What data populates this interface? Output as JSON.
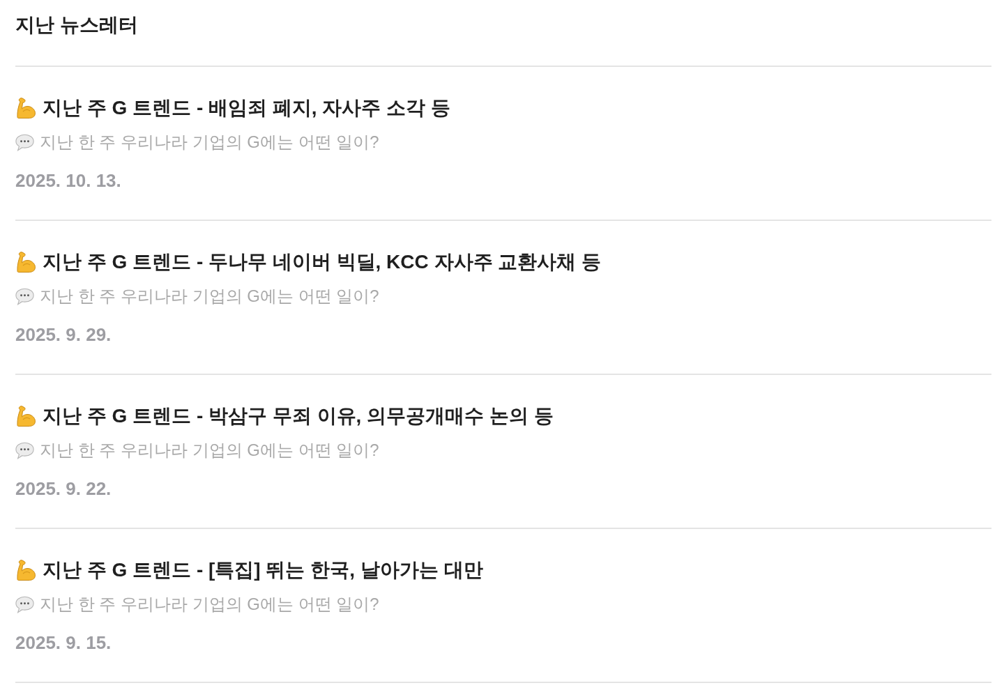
{
  "title": "지난 뉴스레터",
  "newsletters": [
    {
      "title": "지난 주 G 트렌드 - 배임죄 폐지, 자사주 소각 등",
      "summary": "지난 한 주 우리나라 기업의 G에는 어떤 일이?",
      "date": "2025. 10. 13."
    },
    {
      "title": "지난 주 G 트렌드 - 두나무 네이버 빅딜, KCC 자사주 교환사채 등",
      "summary": "지난 한 주 우리나라 기업의 G에는 어떤 일이?",
      "date": "2025. 9. 29."
    },
    {
      "title": "지난 주 G 트렌드 - 박삼구 무죄 이유, 의무공개매수 논의 등",
      "summary": "지난 한 주 우리나라 기업의 G에는 어떤 일이?",
      "date": "2025. 9. 22."
    },
    {
      "title": "지난 주 G 트렌드 - [특집] 뛰는 한국, 날아가는 대만",
      "summary": "지난 한 주 우리나라 기업의 G에는 어떤 일이?",
      "date": "2025. 9. 15."
    }
  ]
}
